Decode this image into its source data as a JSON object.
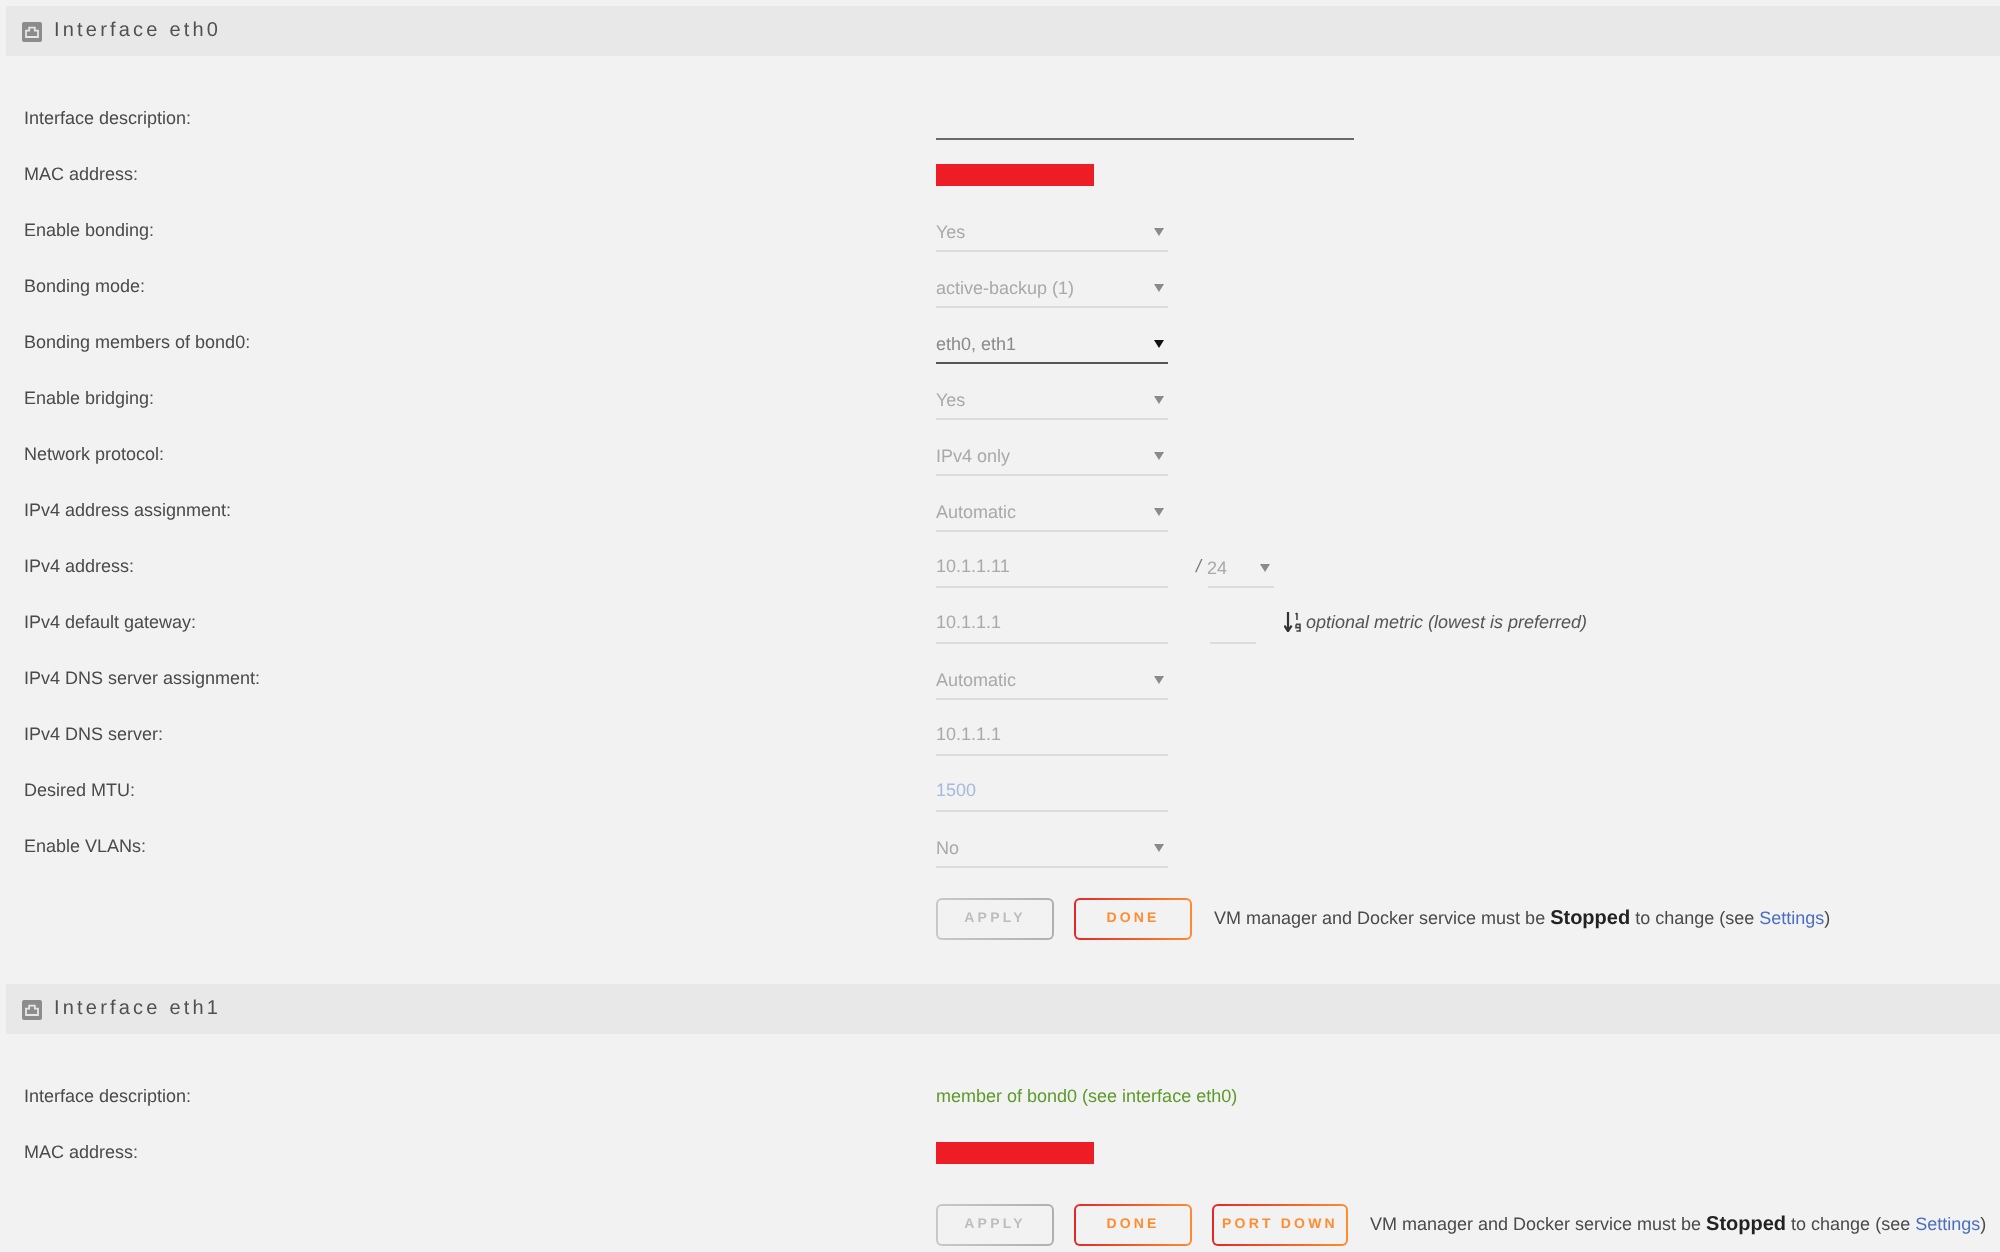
{
  "sections": [
    {
      "title": "Interface eth0",
      "rows": [
        {
          "label": "Interface description:",
          "kind": "long_input",
          "disabled": false
        },
        {
          "label": "MAC address:",
          "kind": "redacted"
        },
        {
          "label": "Enable bonding:",
          "kind": "select",
          "value": "Yes",
          "disabled": true
        },
        {
          "label": "Bonding mode:",
          "kind": "select",
          "value": "active-backup (1)",
          "disabled": true
        },
        {
          "label": "Bonding members of bond0:",
          "kind": "select",
          "value": "eth0, eth1",
          "disabled": false
        },
        {
          "label": "Enable bridging:",
          "kind": "select",
          "value": "Yes",
          "disabled": true
        },
        {
          "label": "Network protocol:",
          "kind": "select",
          "value": "IPv4 only",
          "disabled": true
        },
        {
          "label": "IPv4 address assignment:",
          "kind": "select",
          "value": "Automatic",
          "disabled": true
        },
        {
          "label": "IPv4 address:",
          "kind": "address",
          "value": "10.1.1.11",
          "disabled": true,
          "separator": "/",
          "prefix": {
            "value": "24",
            "disabled": true
          }
        },
        {
          "label": "IPv4 default gateway:",
          "kind": "gateway",
          "value": "10.1.1.1",
          "disabled": true,
          "metric": {
            "disabled": true
          },
          "hint": "optional metric (lowest is preferred)"
        },
        {
          "label": "IPv4 DNS server assignment:",
          "kind": "select",
          "value": "Automatic",
          "disabled": true
        },
        {
          "label": "IPv4 DNS server:",
          "kind": "input",
          "value": "10.1.1.1",
          "disabled": true
        },
        {
          "label": "Desired MTU:",
          "kind": "input",
          "placeholder": "1500",
          "disabled": true
        },
        {
          "label": "Enable VLANs:",
          "kind": "select",
          "value": "No",
          "disabled": true
        }
      ],
      "buttons": [
        {
          "label": "APPLY",
          "disabled": true
        },
        {
          "label": "DONE",
          "disabled": false
        }
      ],
      "note": {
        "before": "VM manager and Docker service must be **Stopped** to change (see ",
        "link": "Settings",
        "after": ")"
      }
    },
    {
      "title": "Interface eth1",
      "rows": [
        {
          "label": "Interface description:",
          "kind": "text",
          "value": "member of bond0 (see interface eth0)"
        },
        {
          "label": "MAC address:",
          "kind": "redacted"
        }
      ],
      "buttons": [
        {
          "label": "APPLY",
          "disabled": true
        },
        {
          "label": "DONE",
          "disabled": false
        },
        {
          "label": "PORT DOWN",
          "disabled": false
        }
      ],
      "note": {
        "before": "VM manager and Docker service must be **Stopped** to change (see ",
        "link": "Settings",
        "after": ")"
      }
    }
  ]
}
